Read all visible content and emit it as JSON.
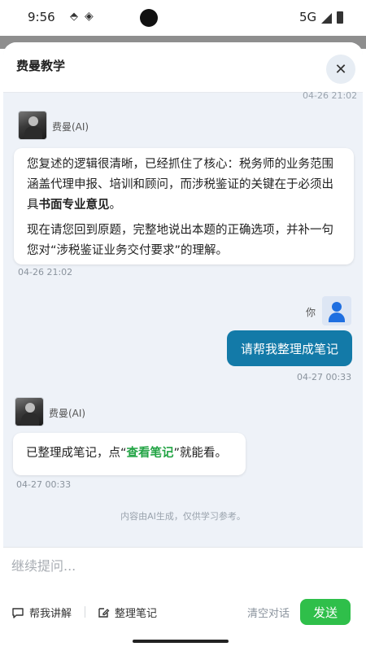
{
  "status_bar": {
    "time": "9:56",
    "network": "5G"
  },
  "sheet": {
    "title": "费曼教学",
    "close_symbol": "✕",
    "cut_timestamp": "04-26 21:02"
  },
  "messages": [
    {
      "sender": "费曼(AI)",
      "paragraph1_pre": "您复述的逻辑很清晰，已经抓住了核心：税务师的业务范围涵盖代理申报、培训和顾问，而涉税鉴证的关键在于必须出具",
      "paragraph1_bold": "书面专业意见",
      "paragraph1_post": "。",
      "paragraph2": "现在请您回到原题，完整地说出本题的正确选项，并补一句您对“涉税鉴证业务交付要求”的理解。",
      "timestamp": "04-26 21:02"
    },
    {
      "sender": "你",
      "text": "请帮我整理成笔记",
      "timestamp": "04-27 00:33"
    },
    {
      "sender": "费曼(AI)",
      "text_pre": "已整理成笔记，点“",
      "link": "查看笔记",
      "text_post": "”就能看。",
      "timestamp": "04-27 00:33"
    }
  ],
  "disclaimer": "内容由AI生成，仅供学习参考。",
  "input": {
    "placeholder": "继续提问...",
    "explain_label": "帮我讲解",
    "notes_label": "整理笔记",
    "clear_label": "清空对话",
    "send_label": "发送"
  },
  "colors": {
    "user_bubble": "#137aa8",
    "send_button": "#2fbf4a",
    "link": "#23a445"
  }
}
